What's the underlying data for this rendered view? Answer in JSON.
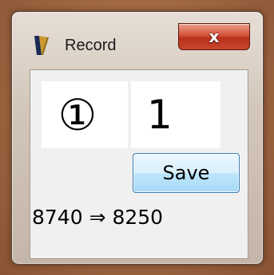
{
  "window": {
    "title": "Record",
    "close_symbol": "x"
  },
  "icons": {
    "app_icon": "app-icon",
    "close_icon": "close-icon"
  },
  "fields": {
    "circled_number": "①",
    "number_value": "1"
  },
  "buttons": {
    "save_label": "Save"
  },
  "result": {
    "text": "8740 ⇒ 8250"
  },
  "colors": {
    "close_button": "#d6523a",
    "save_button": "#bee6fd",
    "client_background": "#f0f0f0",
    "desktop": "#a06a45"
  }
}
